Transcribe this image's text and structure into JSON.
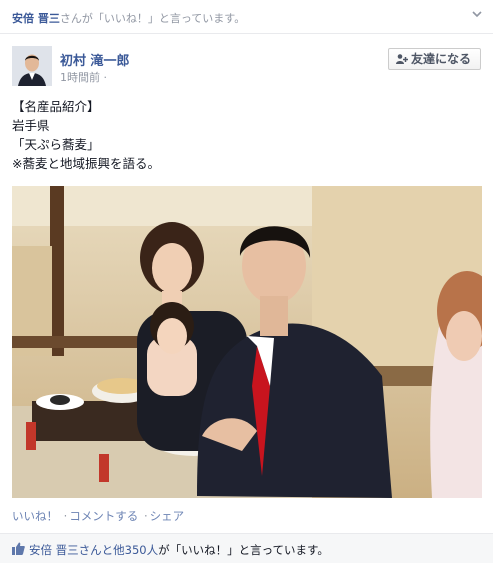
{
  "story_header": {
    "actor": "安倍 晋三",
    "text": "さんが「いいね！」と言っています。"
  },
  "post": {
    "author": "初村 滝一郎",
    "time": "1時間前 ·",
    "add_friend_label": "友達になる",
    "lines": [
      "【名産品紹介】",
      "岩手県",
      "「天ぷら蕎麦」",
      "※蕎麦と地域振興を語る。"
    ]
  },
  "actions": {
    "like": "いいね！",
    "comment": "コメントする",
    "share": "シェア",
    "separator": "·"
  },
  "likes": {
    "actors": "安倍 晋三さんと他350人",
    "suffix": "が「いいね！」と言っています。"
  },
  "colors": {
    "link": "#3b5998",
    "meta": "#9197a3",
    "bar": "#f6f7f8"
  },
  "icons": [
    "chevron-down-icon",
    "add-friend-icon",
    "like-thumb-icon"
  ]
}
